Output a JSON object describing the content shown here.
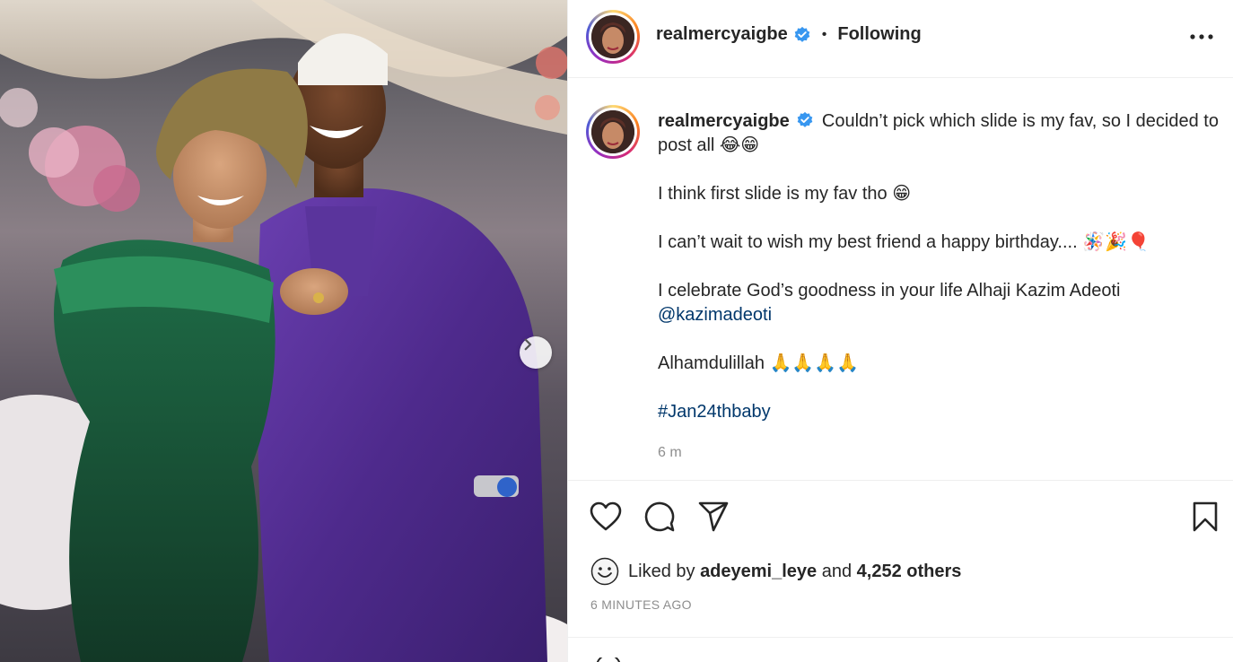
{
  "post": {
    "username": "realmercyaigbe",
    "separator": "•",
    "follow_status": "Following",
    "caption": {
      "line1": "Couldn’t pick which slide is my fav, so I decided to post all 😂😁",
      "line2": "I think first slide is my fav tho 😁",
      "line3": "I can’t wait to wish my best friend a happy birthday.... 🪅🎉🎈",
      "line4_text": "I celebrate God’s goodness in your life Alhaji Kazim Adeoti",
      "line4_mention": "@kazimadeoti",
      "line5": "Alhamdulillah 🙏🙏🙏🙏",
      "hashtag": "#Jan24thbaby"
    },
    "caption_age": "6 m",
    "liked_by_prefix": "Liked by",
    "liked_by_user": "adeyemi_leye",
    "liked_by_and": "and",
    "liked_by_others": "4,252 others",
    "posted_ago": "6 MINUTES AGO"
  },
  "icons": {
    "verified": "verified-badge-icon",
    "more": "more-options-icon",
    "like": "heart-icon",
    "comment": "comment-icon",
    "share": "share-icon",
    "save": "bookmark-icon",
    "next": "chevron-right-icon",
    "liker_avatar": "smiley-avatar-icon"
  },
  "colors": {
    "verified_blue": "#3897f0",
    "link_blue": "#00376b",
    "muted_gray": "#8e8e8e"
  }
}
